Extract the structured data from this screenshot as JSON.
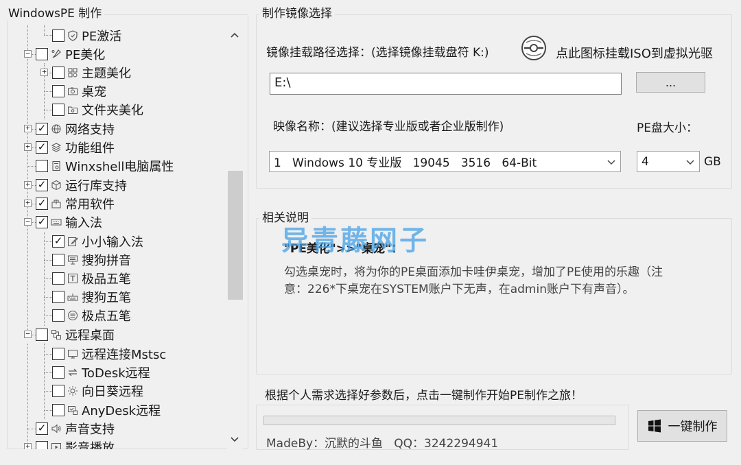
{
  "left": {
    "title": "WindowsPE 制作",
    "tree": [
      {
        "label": "PE激活",
        "checked": false,
        "icon": "shield-icon"
      },
      {
        "label": "PE美化",
        "checked": false,
        "icon": "palette-icon"
      },
      {
        "label": "主题美化",
        "checked": false,
        "icon": "theme-icon"
      },
      {
        "label": "桌宠",
        "checked": false,
        "icon": "camera-icon"
      },
      {
        "label": "文件夹美化",
        "checked": false,
        "icon": "folder-icon"
      },
      {
        "label": "网络支持",
        "checked": true,
        "icon": "globe-icon"
      },
      {
        "label": "功能组件",
        "checked": true,
        "icon": "layers-icon"
      },
      {
        "label": "Winxshell电脑属性",
        "checked": false,
        "icon": "settings-doc-icon"
      },
      {
        "label": "运行库支持",
        "checked": true,
        "icon": "cube-icon"
      },
      {
        "label": "常用软件",
        "checked": true,
        "icon": "box-icon"
      },
      {
        "label": "输入法",
        "checked": true,
        "icon": "keyboard-icon"
      },
      {
        "label": "小小输入法",
        "checked": true,
        "icon": "edit-icon"
      },
      {
        "label": "搜狗拼音",
        "checked": false,
        "icon": "ime-icon"
      },
      {
        "label": "极品五笔",
        "checked": false,
        "icon": "text-box-icon"
      },
      {
        "label": "搜狗五笔",
        "checked": false,
        "icon": "keyboard-small-icon"
      },
      {
        "label": "极点五笔",
        "checked": false,
        "icon": "list-circle-icon"
      },
      {
        "label": "远程桌面",
        "checked": false,
        "icon": "remote-icon"
      },
      {
        "label": "远程连接Mstsc",
        "checked": false,
        "icon": "monitor-icon"
      },
      {
        "label": "ToDesk远程",
        "checked": false,
        "icon": "arrows-icon"
      },
      {
        "label": "向日葵远程",
        "checked": false,
        "icon": "sun-icon"
      },
      {
        "label": "AnyDesk远程",
        "checked": false,
        "icon": "anydesk-icon"
      },
      {
        "label": "声音支持",
        "checked": true,
        "icon": "speaker-icon"
      },
      {
        "label": "影音播放",
        "checked": false,
        "icon": "media-icon"
      }
    ],
    "check_glyph": "✓"
  },
  "image": {
    "title": "制作镜像选择",
    "mount_label": "镜像挂载路径选择：(选择镜像挂载盘符 K:)",
    "mount_hint": "点此图标挂载ISO到虚拟光驱",
    "path_value": "E:\\",
    "browse_label": "...",
    "image_name_label": "映像名称：(建议选择专业版或者企业版制作)",
    "pe_size_label": "PE盘大小：",
    "image_select_value": "1   Windows 10 专业版   19045   3516   64-Bit",
    "size_select_value": "4",
    "size_unit": "GB"
  },
  "desc": {
    "title": "相关说明",
    "heading": "\"PE美化\">>\"桌宠\"：",
    "line1": "勾选桌宠时，将为你的PE桌面添加卡哇伊桌宠，增加了PE使用的乐趣（注",
    "line2": "意：226*下桌宠在SYSTEM账户下无声，在admin账户下有声音）。"
  },
  "watermark": "异青藤网子",
  "bottom": {
    "hint": "根据个人需求选择好参数后，点击一键制作开始PE制作之旅！",
    "progress": 0,
    "madeby": "MadeBy：沉默的斗鱼   QQ：3242294941",
    "make_button": "一键制作"
  },
  "colors": {
    "window_bg": "#f0f0f0",
    "border": "#dcdcdc",
    "progress_fill": "#06b025",
    "watermark": "#46a0e6"
  }
}
